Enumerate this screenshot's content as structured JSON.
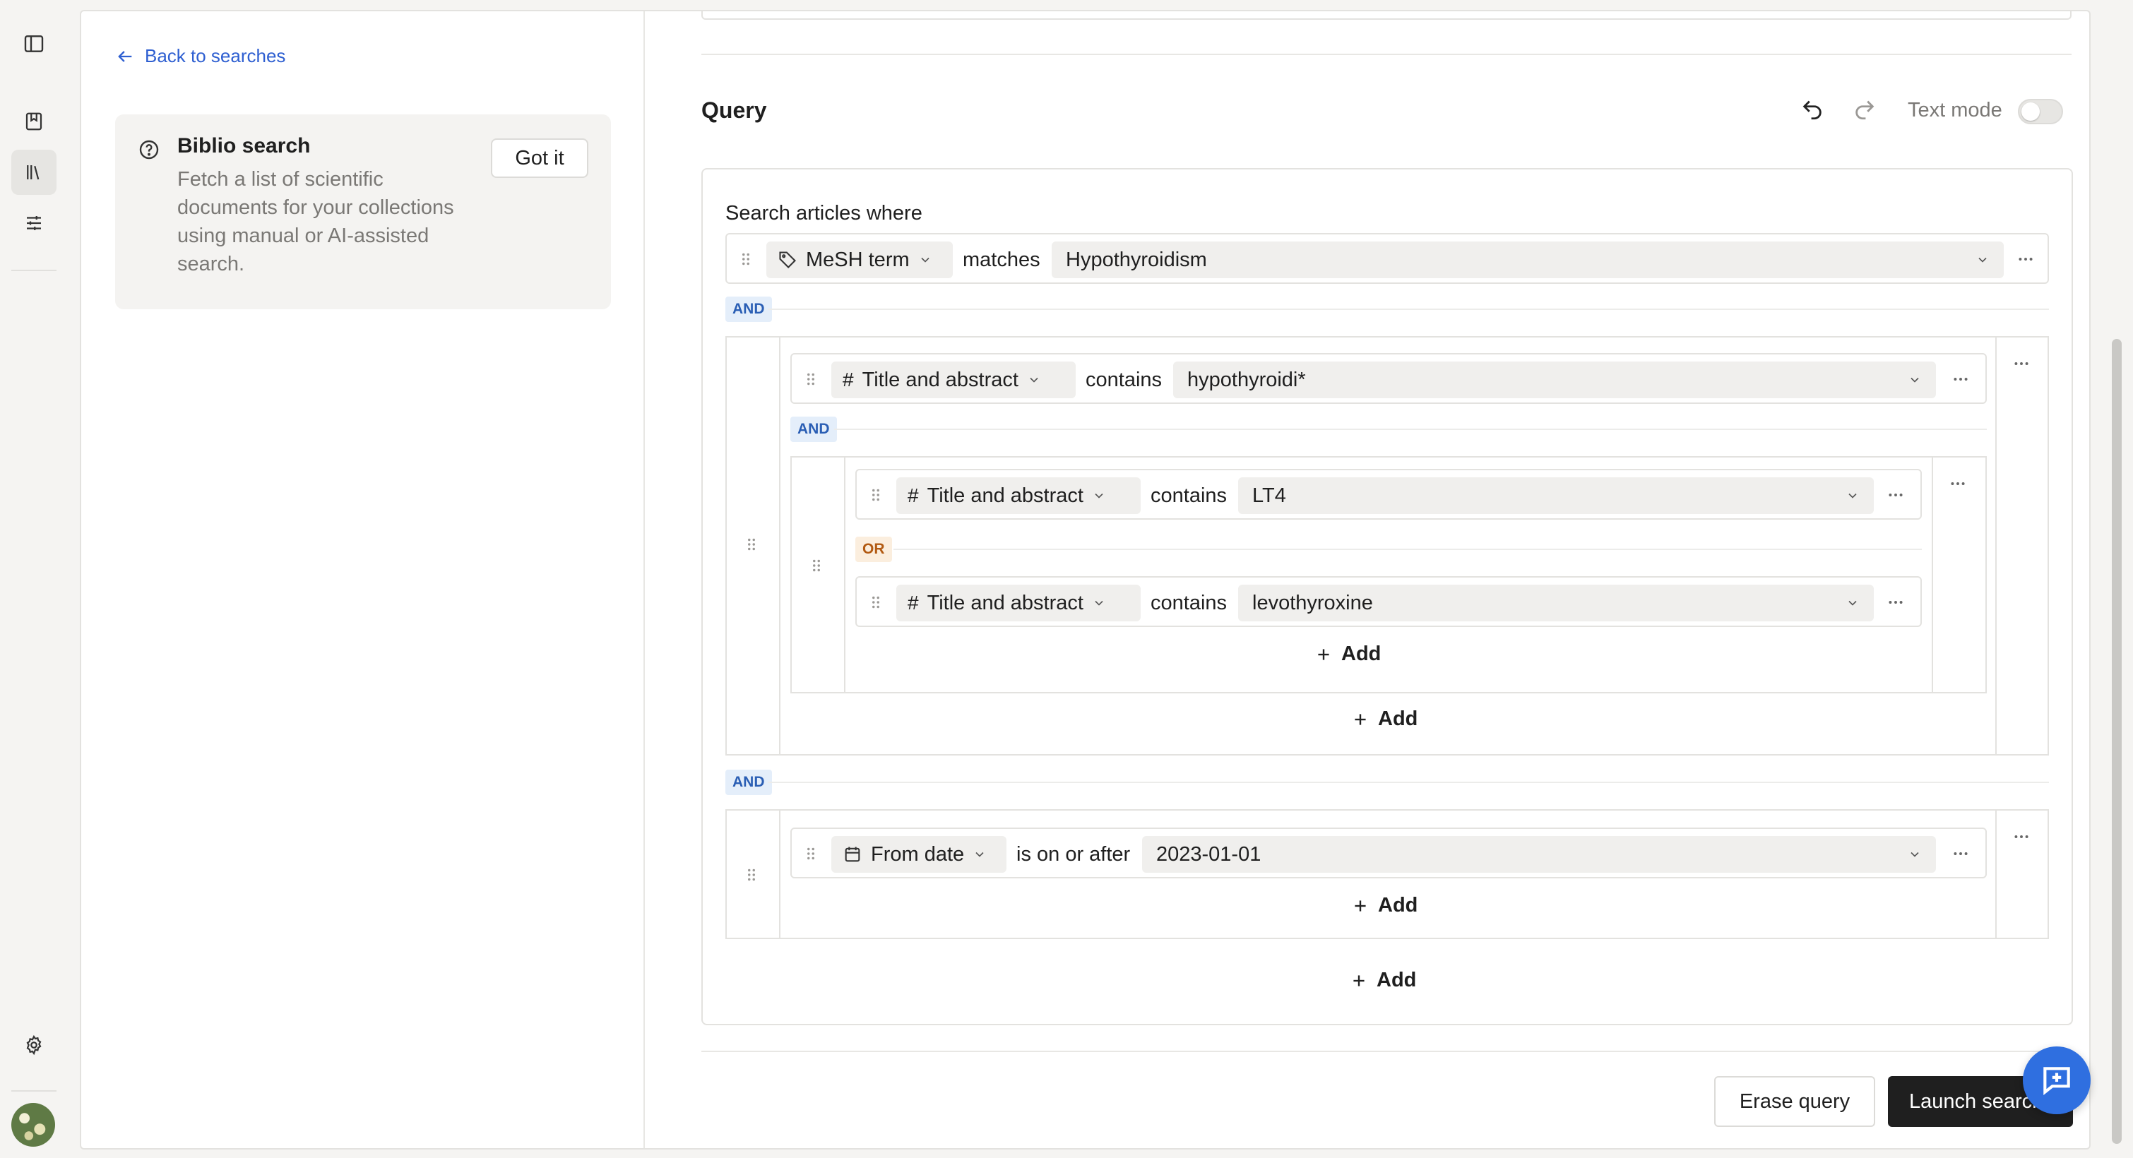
{
  "back_link": "Back to searches",
  "info": {
    "title": "Biblio search",
    "text": "Fetch a list of scientific documents for your collections using manual or AI-assisted search.",
    "got_it": "Got it"
  },
  "query": {
    "title": "Query",
    "text_mode_label": "Text mode",
    "text_mode_on": false,
    "search_where": "Search articles where",
    "add_label": "Add",
    "and_label": "AND",
    "or_label": "OR",
    "conditions": [
      {
        "field": "MeSH term",
        "operator": "matches",
        "value": "Hypothyroidism"
      },
      {
        "field": "Title and abstract",
        "operator": "contains",
        "value": "hypothyroidi*"
      },
      {
        "field": "Title and abstract",
        "operator": "contains",
        "value": "LT4"
      },
      {
        "field": "Title and abstract",
        "operator": "contains",
        "value": "levothyroxine"
      },
      {
        "field": "From date",
        "operator": "is on or after",
        "value": "2023-01-01"
      }
    ]
  },
  "footer": {
    "erase": "Erase query",
    "launch": "Launch search"
  },
  "colors": {
    "accent_blue": "#2e5fd1",
    "primary_button": "#1f1f1f",
    "and_badge": "#2a5eb4",
    "or_badge": "#b25a12",
    "chat_button": "#2f6fe0"
  }
}
